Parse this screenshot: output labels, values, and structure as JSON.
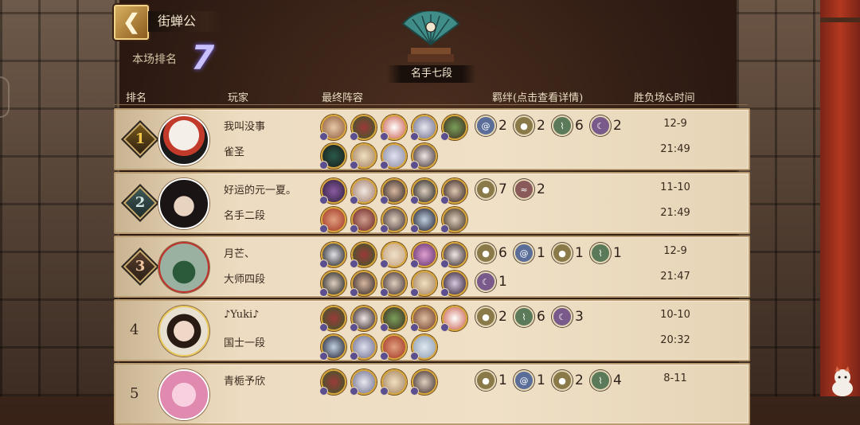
{
  "header": {
    "title": "街蝉公",
    "rank_label": "本场排名",
    "rank_value": "7",
    "tier_banner": "名手七段"
  },
  "columns": {
    "rank": "排名",
    "player": "玩家",
    "lineup": "最终阵容",
    "bonds": "羁绊(点击查看详情)",
    "result_time": "胜负场&时间"
  },
  "icons": {
    "back": "back-arrow-icon",
    "fan": "paper-fan-trophy-icon",
    "bond_blue": "swirl-bond-icon",
    "bond_gold": "mask-bond-icon",
    "bond_green": "leaf-bond-icon",
    "bond_purple": "moon-bond-icon",
    "bond_red": "flame-bond-icon"
  },
  "colors": {
    "accent_gold": "#d7a53a",
    "rank_value": "#c9c0ff",
    "row_bg": "#efe0c6"
  },
  "rows": [
    {
      "rank": "1",
      "name": "我叫没事",
      "tier": "雀圣",
      "score": "12-9",
      "time": "21:49",
      "bonds": [
        {
          "type": "blue",
          "count": "2"
        },
        {
          "type": "gold",
          "count": "2"
        },
        {
          "type": "green",
          "count": "6"
        },
        {
          "type": "purple",
          "count": "2"
        }
      ]
    },
    {
      "rank": "2",
      "name": "好运的元一夏。",
      "tier": "名手二段",
      "score": "11-10",
      "time": "21:49",
      "bonds": [
        {
          "type": "gold",
          "count": "7"
        },
        {
          "type": "red",
          "count": "2"
        }
      ]
    },
    {
      "rank": "3",
      "name": "月芒、",
      "tier": "大师四段",
      "score": "12-9",
      "time": "21:47",
      "bonds": [
        {
          "type": "gold",
          "count": "6"
        },
        {
          "type": "blue",
          "count": "1"
        },
        {
          "type": "gold",
          "count": "1"
        },
        {
          "type": "green",
          "count": "1"
        },
        {
          "type": "purple",
          "count": "1"
        }
      ]
    },
    {
      "rank": "4",
      "name": "♪Yuki♪",
      "tier": "国士一段",
      "score": "10-10",
      "time": "20:32",
      "bonds": [
        {
          "type": "gold",
          "count": "2"
        },
        {
          "type": "green",
          "count": "6"
        },
        {
          "type": "purple",
          "count": "3"
        }
      ]
    },
    {
      "rank": "5",
      "name": "青栀予欣",
      "tier": "",
      "score": "8-11",
      "time": "",
      "bonds": [
        {
          "type": "gold",
          "count": "1"
        },
        {
          "type": "blue",
          "count": "1"
        },
        {
          "type": "gold",
          "count": "2"
        },
        {
          "type": "green",
          "count": "4"
        }
      ]
    }
  ]
}
